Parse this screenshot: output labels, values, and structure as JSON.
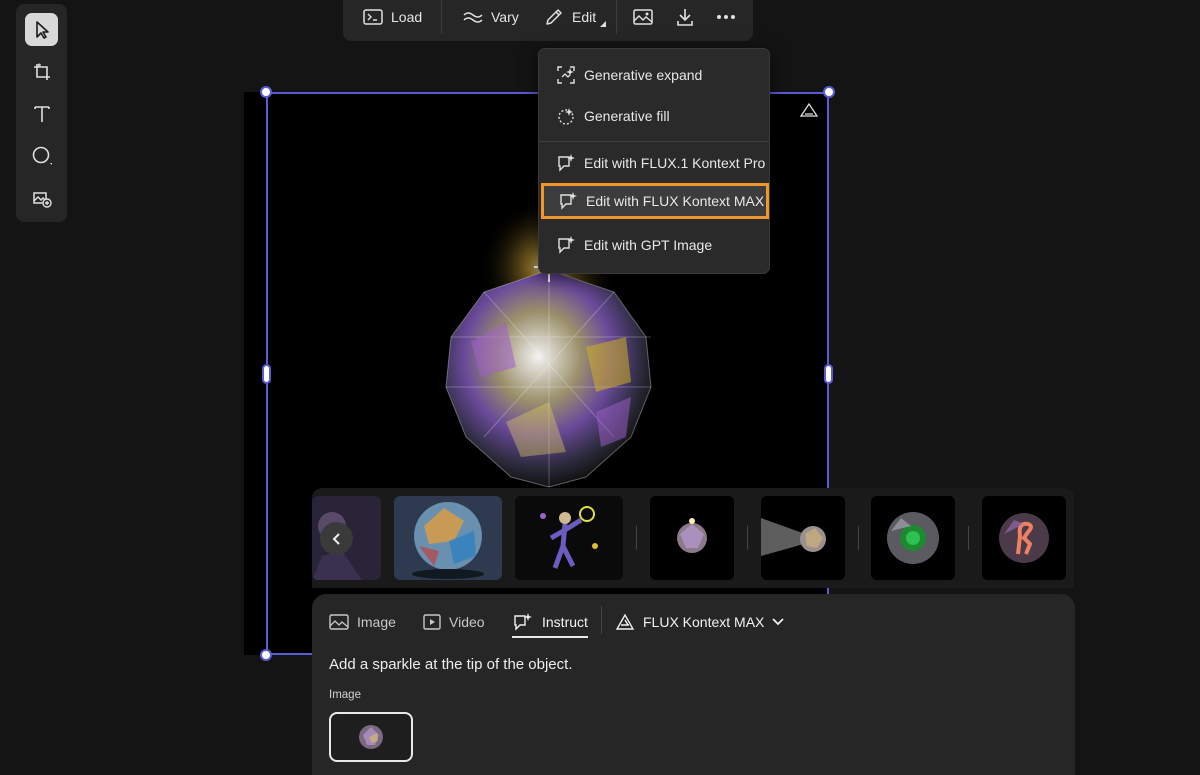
{
  "left_toolbar": {
    "tools": [
      {
        "name": "select",
        "icon": "pointer-icon",
        "active": true
      },
      {
        "name": "artboard",
        "icon": "artboard-icon",
        "active": false
      },
      {
        "name": "text",
        "icon": "text-icon",
        "active": false
      },
      {
        "name": "shape",
        "icon": "circle-shape-icon",
        "active": false
      },
      {
        "name": "add-image",
        "icon": "image-add-icon",
        "active": false
      }
    ]
  },
  "top_toolbar": {
    "load_label": "Load",
    "vary_label": "Vary",
    "edit_label": "Edit"
  },
  "edit_menu": {
    "items": [
      {
        "label": "Generative expand",
        "icon": "generative-expand-icon"
      },
      {
        "label": "Generative fill",
        "icon": "generative-fill-icon"
      },
      {
        "label": "Edit with FLUX.1 Kontext Pro",
        "icon": "chat-sparkle-icon"
      },
      {
        "label": "Edit with FLUX Kontext MAX",
        "icon": "chat-sparkle-icon",
        "highlighted": true
      },
      {
        "label": "Edit with GPT Image",
        "icon": "chat-sparkle-icon"
      }
    ]
  },
  "bottom_panel": {
    "tabs": [
      {
        "label": "Image",
        "icon": "image-icon"
      },
      {
        "label": "Video",
        "icon": "video-icon"
      },
      {
        "label": "Instruct",
        "icon": "chat-sparkle-icon",
        "active": true
      }
    ],
    "model_label": "FLUX Kontext MAX",
    "prompt": "Add a sparkle at the tip of the object.",
    "image_section_label": "Image"
  },
  "colors": {
    "accent_selection": "#5b5bd6",
    "highlight_border": "#f0962b",
    "panel_bg": "#262626",
    "app_bg": "#141414"
  }
}
